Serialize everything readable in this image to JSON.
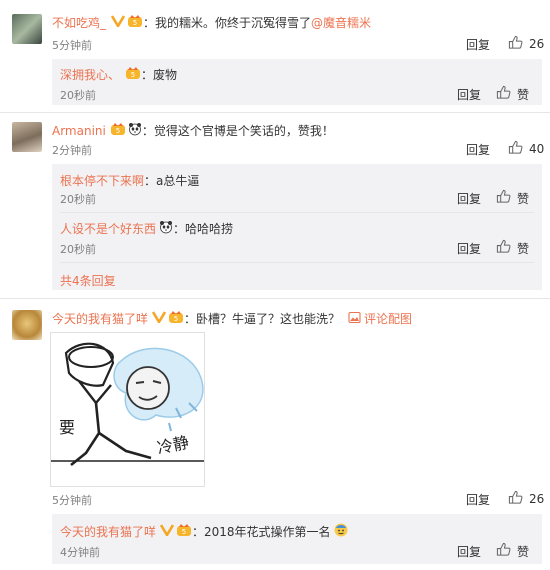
{
  "comments": [
    {
      "user": "不如吃鸡_",
      "text": "：我的糯米。你终于沉冤得雪了",
      "mention": "@魔音糯米",
      "time": "5分钟前",
      "reply_label": "回复",
      "like_count": "26",
      "replies": [
        {
          "user": "深拥我心、",
          "text": "：废物",
          "time": "20秒前",
          "reply_label": "回复",
          "like_label": "赞"
        }
      ]
    },
    {
      "user": "Armanini",
      "text": "：觉得这个官博是个笑话的，赞我！",
      "time": "2分钟前",
      "reply_label": "回复",
      "like_count": "40",
      "replies": [
        {
          "user": "根本停不下来啊",
          "text": "：a总牛逼",
          "time": "20秒前",
          "reply_label": "回复",
          "like_label": "赞"
        },
        {
          "user": "人设不是个好东西",
          "text": "：哈哈哈捞",
          "time": "20秒前",
          "reply_label": "回复",
          "like_label": "赞"
        }
      ],
      "more_replies": "共4条回复"
    },
    {
      "user": "今天的我有猫了咩",
      "text": "：卧槽？牛逼了？这也能洗？",
      "pic_link": "评论配图",
      "image_text_left": "要",
      "image_text_right": "冷静",
      "time": "5分钟前",
      "reply_label": "回复",
      "like_count": "26",
      "replies": [
        {
          "user": "今天的我有猫了咩",
          "text": "：2018年花式操作第一名",
          "time": "4分钟前",
          "reply_label": "回复",
          "like_label": "赞"
        }
      ]
    }
  ],
  "colors": {
    "accent": "#eb7350",
    "sub_bg": "#f2f2f5",
    "vip": "#f5a623"
  },
  "icons": {
    "like": "thumb-up-icon",
    "vip": "vip-v-icon",
    "crown": "member-badge-icon",
    "panda": "panda-badge-icon",
    "pic": "image-icon"
  }
}
